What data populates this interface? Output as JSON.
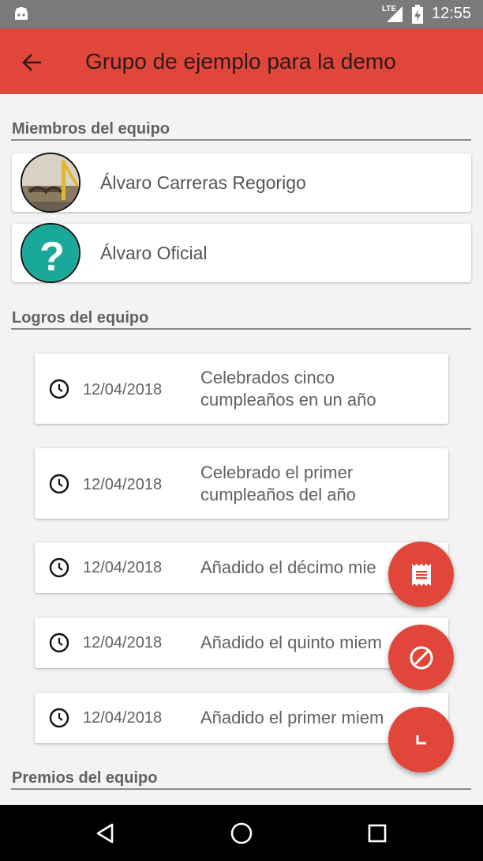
{
  "status_bar": {
    "time": "12:55",
    "network_label": "LTE",
    "icons": [
      "android-icon",
      "signal-icon",
      "battery-charging-icon"
    ]
  },
  "app_bar": {
    "title": "Grupo de ejemplo para la demo",
    "back_icon": "arrow-back-icon",
    "color": "#e0473a"
  },
  "members_section": {
    "title": "Miembros del equipo",
    "members": [
      {
        "name": "Álvaro Carreras Regorigo",
        "avatar": "photo-avatar"
      },
      {
        "name": "Álvaro Oficial",
        "avatar": "question-mark-avatar"
      }
    ]
  },
  "achievements_section": {
    "title": "Logros del equipo",
    "items": [
      {
        "date": "12/04/2018",
        "description": "Celebrados cinco cumpleaños en un año",
        "line1": "Celebrados cinco",
        "line2": "cumpleaños en un año"
      },
      {
        "date": "12/04/2018",
        "description": "Celebrado el primer cumpleaños del año",
        "line1": "Celebrado el primer",
        "line2": "cumpleaños del año"
      },
      {
        "date": "12/04/2018",
        "description": "Añadido el décimo mie"
      },
      {
        "date": "12/04/2018",
        "description": "Añadido el quinto miem"
      },
      {
        "date": "12/04/2018",
        "description": "Añadido el primer miem"
      }
    ]
  },
  "awards_section": {
    "title": "Premios del equipo"
  },
  "fabs": [
    {
      "name": "receipt-fab",
      "icon": "receipt-icon"
    },
    {
      "name": "block-fab",
      "icon": "block-icon"
    },
    {
      "name": "corner-fab",
      "icon": "corner-icon"
    }
  ],
  "nav_bar": {
    "buttons": [
      "back-triangle-icon",
      "home-circle-icon",
      "recents-square-icon"
    ]
  }
}
